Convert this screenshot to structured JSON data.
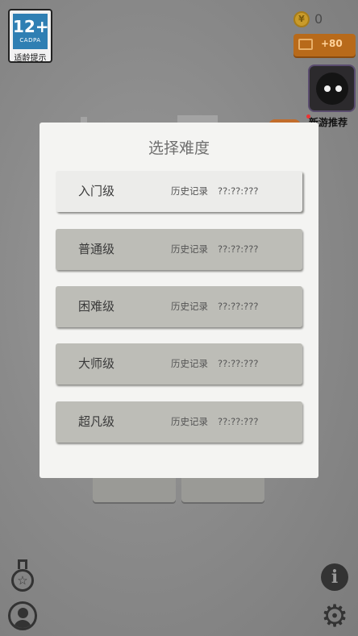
{
  "topbar": {
    "age_rating": {
      "number": "12+",
      "org": "CADPA",
      "tip": "适龄提示"
    },
    "coins": {
      "count": "0"
    },
    "video_reward": {
      "label": "+80"
    },
    "new_games": {
      "label": "新游推荐"
    }
  },
  "modal": {
    "title": "选择难度",
    "levels": [
      {
        "name": "入门级",
        "history_label": "历史记录",
        "time": "??:??:???",
        "selected": true
      },
      {
        "name": "普通级",
        "history_label": "历史记录",
        "time": "??:??:???",
        "selected": false
      },
      {
        "name": "困难级",
        "history_label": "历史记录",
        "time": "??:??:???",
        "selected": false
      },
      {
        "name": "大师级",
        "history_label": "历史记录",
        "time": "??:??:???",
        "selected": false
      },
      {
        "name": "超凡级",
        "history_label": "历史记录",
        "time": "??:??:???",
        "selected": false
      }
    ]
  },
  "icons": {
    "achievements": "medal-icon",
    "profile": "user-icon",
    "info": "info-icon",
    "settings": "gear-icon"
  },
  "colors": {
    "overlay": "#8d8d8d",
    "modal_bg": "#f4f4f2",
    "level_bg": "#bdbdb7",
    "level_selected_bg": "#ececea",
    "video_button": "#b86a1a"
  }
}
